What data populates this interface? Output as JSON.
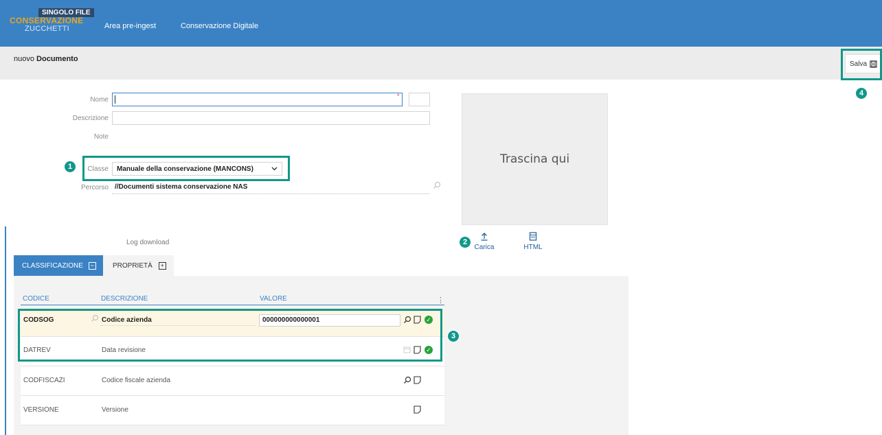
{
  "header": {
    "badge": "SINGOLO FILE",
    "logo_top": "CONSERVAZIONE",
    "logo_bottom": "ZUCCHETTI",
    "nav": [
      "Area pre-ingest",
      "Conservazione Digitale"
    ]
  },
  "titlebar": {
    "prefix": "nuovo",
    "title": "Documento",
    "save_label": "Salva"
  },
  "form": {
    "nome_label": "Nome",
    "descrizione_label": "Descrizione",
    "note_label": "Note",
    "classe_label": "Classe",
    "classe_value": "Manuale della conservazione (MANCONS)",
    "percorso_label": "Percorso",
    "percorso_value": "//Documenti sistema conservazione NAS",
    "log_download": "Log download"
  },
  "dropzone": {
    "text": "Trascina qui",
    "upload_label": "Carica",
    "html_label": "HTML"
  },
  "tabs": [
    "CLASSIFICAZIONE",
    "PROPRIETÀ"
  ],
  "table": {
    "headers": [
      "CODICE",
      "DESCRIZIONE",
      "VALORE"
    ],
    "rows": [
      {
        "code": "CODSOG",
        "desc": "Codice azienda",
        "value": "000000000000001"
      },
      {
        "code": "DATREV",
        "desc": "Data revisione",
        "value": ""
      },
      {
        "code": "CODFISCAZI",
        "desc": "Codice fiscale azienda",
        "value": ""
      },
      {
        "code": "VERSIONE",
        "desc": "Versione",
        "value": ""
      }
    ]
  },
  "markers": [
    "1",
    "2",
    "3",
    "4"
  ],
  "colors": {
    "primary": "#3b82c4",
    "highlight": "#12978b",
    "logo_accent": "#e8a424",
    "ok": "#2aa33a"
  }
}
